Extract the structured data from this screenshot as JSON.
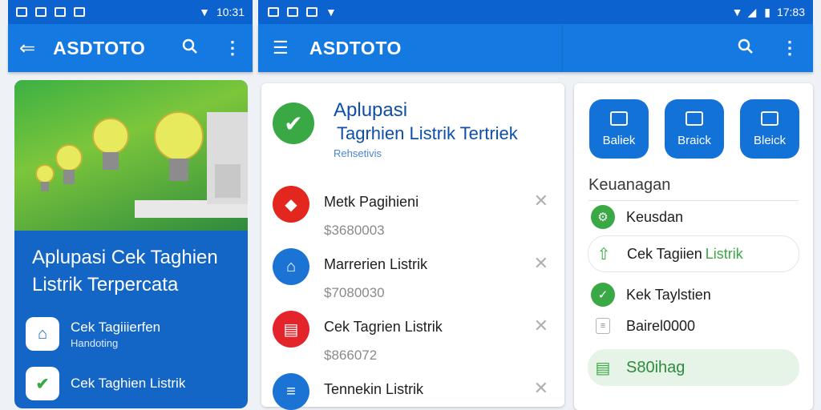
{
  "left_screen": {
    "status_time": "10:31",
    "app_title": "ASDTOTO",
    "hero": {
      "title": "Aplupasi Cek Taghien Listrik Terpercata",
      "rows": [
        {
          "title": "Cek Tagiiierfen",
          "subtitle": "Handoting"
        },
        {
          "title": "Cek Taghien Listrik",
          "subtitle": ""
        }
      ]
    }
  },
  "middle_screen": {
    "status_time": "",
    "app_title": "ASDTOTO",
    "header_card": {
      "title_line1": "Aplupasi",
      "title_line2": "Tagrhien Listrik Tertriek",
      "subtitle": "Rehsetivis"
    },
    "bills": [
      {
        "title": "Metk Pagihieni",
        "amount": "$3680003",
        "color": "#e3261e",
        "icon": "tag-icon"
      },
      {
        "title": "Marrerien Listrik",
        "amount": "$7080030",
        "color": "#1b74d4",
        "icon": "building-icon"
      },
      {
        "title": "Cek Tagrien Listrik",
        "amount": "$866072",
        "color": "#e3242b",
        "icon": "document-icon"
      },
      {
        "title": "Tennekin Listrik",
        "amount": "",
        "color": "#1b74d4",
        "icon": "receipt-icon"
      }
    ]
  },
  "right_screen": {
    "status_time": "17:83",
    "quick_actions": [
      {
        "label": "Baliek",
        "icon": "home-icon"
      },
      {
        "label": "Braick",
        "icon": "clock-icon"
      },
      {
        "label": "Bleick",
        "icon": "chart-icon"
      }
    ],
    "section_title": "Keuanagan",
    "finance_items": [
      {
        "label": "Keusdan",
        "accent": ""
      },
      {
        "label": "Cek Tagiien ",
        "accent": "Listrik"
      },
      {
        "label": "Kek Taylstien",
        "accent": ""
      },
      {
        "label": "Bairel0000",
        "accent": ""
      },
      {
        "label": "",
        "accent": "S80ihag"
      }
    ]
  },
  "colors": {
    "primary": "#1479e0",
    "status": "#0c63cf",
    "hero_bg": "#1466c6",
    "green": "#39a845",
    "red": "#e3261e"
  }
}
